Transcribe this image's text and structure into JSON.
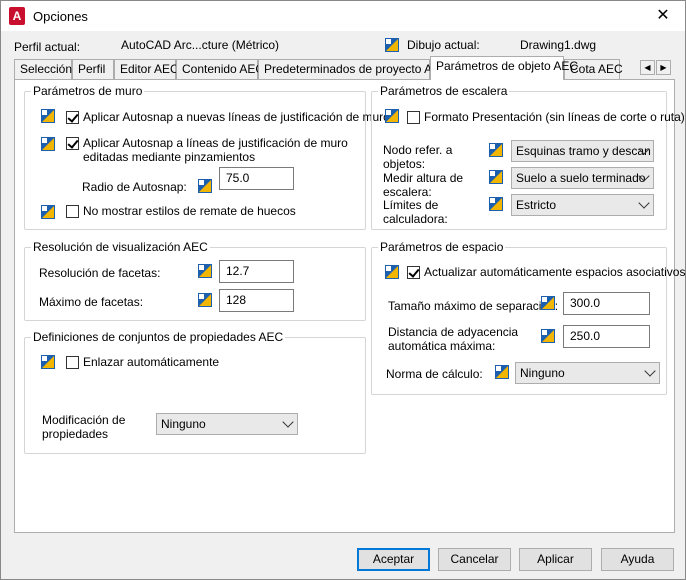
{
  "window": {
    "title": "Opciones",
    "app_letter": "A",
    "close": "✕"
  },
  "profile": {
    "profile_label": "Perfil actual:",
    "profile_value": "AutoCAD Arc...cture (Métrico)",
    "drawing_label": "Dibujo actual:",
    "drawing_value": "Drawing1.dwg"
  },
  "tabs": [
    "Selección",
    "Perfil",
    "Editor AEC",
    "Contenido AEC",
    "Predeterminados de proyecto AEC",
    "Parámetros de objeto AEC",
    "Cota AEC"
  ],
  "tab_nav": {
    "prev": "◀",
    "next": "▶"
  },
  "wall": {
    "legend": "Parámetros de muro",
    "autosnap_new": "Aplicar Autosnap a nuevas líneas de justificación de muro",
    "autosnap_edit_1": "Aplicar Autosnap a líneas de justificación de muro",
    "autosnap_edit_2": "editadas mediante pinzamientos",
    "radius_label": "Radio de Autosnap:",
    "radius_value": "75.0",
    "no_endcap": "No mostrar estilos de remate de huecos"
  },
  "resolution": {
    "legend": "Resolución de visualización AEC",
    "facet_res_label": "Resolución de facetas:",
    "facet_res_value": "12.7",
    "max_facets_label": "Máximo de facetas:",
    "max_facets_value": "128"
  },
  "propsets": {
    "legend": "Definiciones de conjuntos de propiedades AEC",
    "auto_link": "Enlazar automáticamente",
    "modify_label_1": "Modificación de",
    "modify_label_2": "propiedades",
    "modify_value": "Ninguno"
  },
  "stair": {
    "legend": "Parámetros de escalera",
    "presentation": "Formato Presentación (sin líneas de corte o ruta)",
    "node_label_1": "Nodo refer. a",
    "node_label_2": "objetos:",
    "node_value": "Esquinas tramo y descan",
    "measure_label_1": "Medir altura de",
    "measure_label_2": "escalera:",
    "measure_value": "Suelo a suelo terminado",
    "limits_label_1": "Límites de",
    "limits_label_2": "calculadora:",
    "limits_value": "Estricto"
  },
  "space": {
    "legend": "Parámetros de espacio",
    "auto_update": "Actualizar automáticamente espacios asociativos",
    "max_sep_label": "Tamaño máximo de separación:",
    "max_sep_value": "300.0",
    "adj_label_1": "Distancia de adyacencia",
    "adj_label_2": "automática máxima:",
    "adj_value": "250.0",
    "norm_label": "Norma de cálculo:",
    "norm_value": "Ninguno"
  },
  "buttons": {
    "accept": "Aceptar",
    "cancel": "Cancelar",
    "apply": "Aplicar",
    "help": "Ayuda"
  },
  "colors": {
    "accent": "#0078d7",
    "app_icon": "#c8102e",
    "icon_blue": "#1b5fae",
    "icon_yellow": "#f2b600"
  }
}
